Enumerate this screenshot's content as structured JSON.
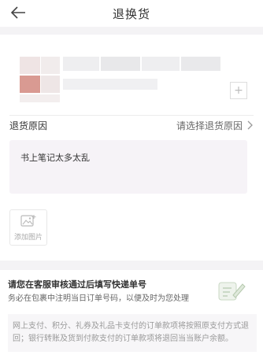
{
  "header": {
    "title": "退换货",
    "back_icon": "back-arrow-icon"
  },
  "product": {
    "add_icon": "plus-icon"
  },
  "return_reason": {
    "label": "退货原因",
    "placeholder": "请选择退货原因",
    "chevron_icon": "chevron-right-icon"
  },
  "description": {
    "value": "书上笔记太多太乱"
  },
  "photo": {
    "label": "添加图片",
    "icon": "image-add-icon"
  },
  "notice": {
    "title": "请您在客服审核通过后填写快递单号",
    "subtitle": "务必在包裹中注明当日订单号码，以便及时为您处理",
    "icon": "edit-form-icon"
  },
  "info": {
    "text": "网上支付、积分、礼券及礼品卡支付的订单款项将按照原支付方式退回；银行转账及货到付款支付的订单款项将退回当当账户余额。"
  },
  "colors": {
    "page_bg": "#ffffff",
    "section_bg": "#f4f3f5",
    "textarea_bg": "#f6f3f7",
    "accent": "#d99a92"
  }
}
